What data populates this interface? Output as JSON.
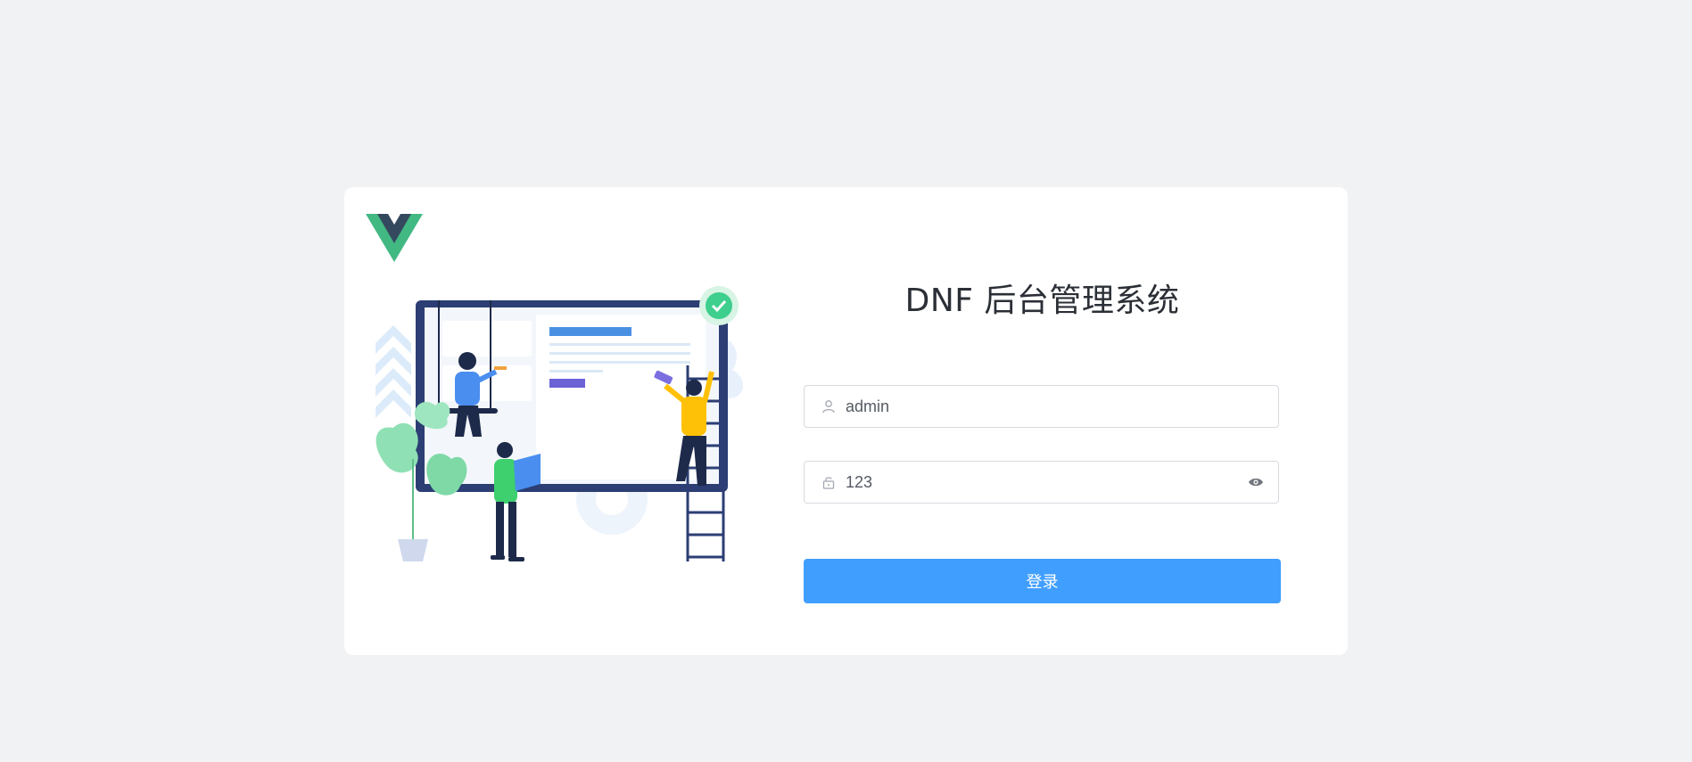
{
  "app": {
    "title": "DNF 后台管理系统"
  },
  "form": {
    "username": {
      "value": "admin",
      "icon": "user-icon"
    },
    "password": {
      "value": "123",
      "icon": "lock-icon",
      "toggle_icon": "eye-icon"
    },
    "submit_label": "登录"
  },
  "colors": {
    "background": "#f1f2f4",
    "card": "#ffffff",
    "primary": "#409eff",
    "title": "#2b2f36",
    "vue_green": "#42b883",
    "vue_dark": "#35495e"
  },
  "images": {
    "logo": "vue-logo",
    "illustration": "team-building-web-page-illustration"
  }
}
